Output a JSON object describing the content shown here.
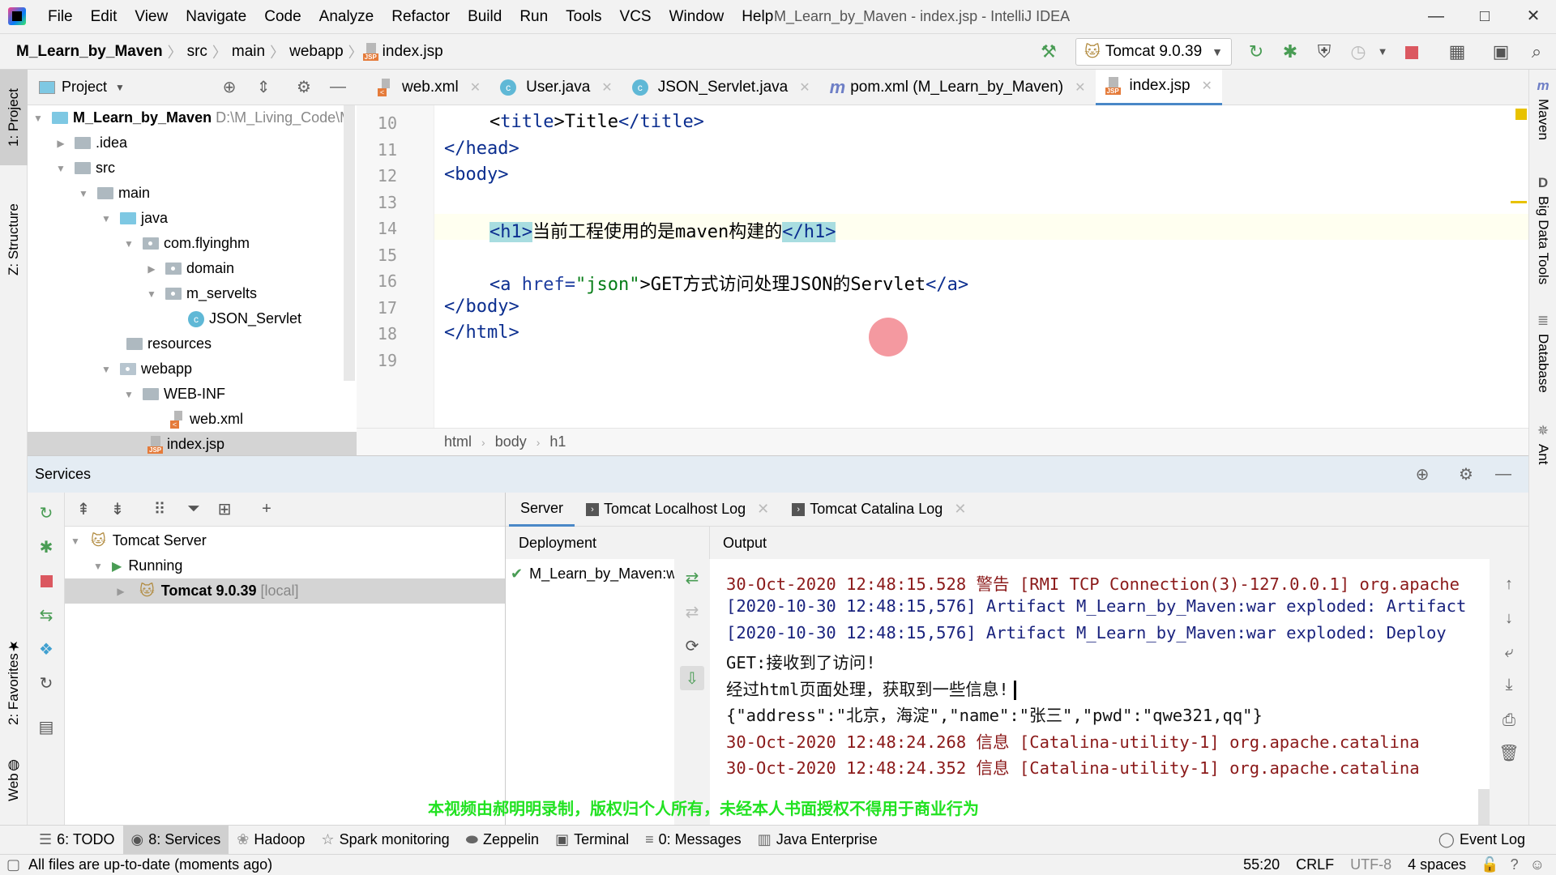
{
  "window": {
    "title": "M_Learn_by_Maven - index.jsp - IntelliJ IDEA",
    "menu": [
      "File",
      "Edit",
      "View",
      "Navigate",
      "Code",
      "Analyze",
      "Refactor",
      "Build",
      "Run",
      "Tools",
      "VCS",
      "Window",
      "Help"
    ],
    "controls": {
      "minimize": "—",
      "maximize": "□",
      "close": "✕"
    }
  },
  "navbar": {
    "breadcrumbs": [
      "M_Learn_by_Maven",
      "src",
      "main",
      "webapp",
      "index.jsp"
    ],
    "run_config": "Tomcat 9.0.39"
  },
  "left_strip": {
    "tabs": [
      "1: Project",
      "Z: Structure",
      "2: Favorites",
      "Web"
    ]
  },
  "right_strip": {
    "tabs": [
      "Maven",
      "Big Data Tools",
      "Database",
      "Ant"
    ]
  },
  "project": {
    "title": "Project",
    "root_path": "D:\\M_Living_Code\\M",
    "tree": [
      {
        "label": "M_Learn_by_Maven",
        "depth": 0,
        "type": "module",
        "expanded": true
      },
      {
        "label": ".idea",
        "depth": 1,
        "type": "folder",
        "expanded": false
      },
      {
        "label": "src",
        "depth": 1,
        "type": "folder",
        "expanded": true
      },
      {
        "label": "main",
        "depth": 2,
        "type": "folder",
        "expanded": true
      },
      {
        "label": "java",
        "depth": 3,
        "type": "src-folder",
        "expanded": true
      },
      {
        "label": "com.flyinghm",
        "depth": 4,
        "type": "package",
        "expanded": true
      },
      {
        "label": "domain",
        "depth": 5,
        "type": "package",
        "expanded": false
      },
      {
        "label": "m_servelts",
        "depth": 5,
        "type": "package",
        "expanded": true
      },
      {
        "label": "JSON_Servlet",
        "depth": 6,
        "type": "class"
      },
      {
        "label": "resources",
        "depth": 3,
        "type": "res-folder"
      },
      {
        "label": "webapp",
        "depth": 3,
        "type": "web-folder",
        "expanded": true
      },
      {
        "label": "WEB-INF",
        "depth": 4,
        "type": "folder",
        "expanded": true
      },
      {
        "label": "web.xml",
        "depth": 5,
        "type": "xml"
      },
      {
        "label": "index.jsp",
        "depth": 4,
        "type": "jsp",
        "selected": true
      }
    ]
  },
  "editor": {
    "tabs": [
      {
        "label": "web.xml",
        "icon": "xml"
      },
      {
        "label": "User.java",
        "icon": "class"
      },
      {
        "label": "JSON_Servlet.java",
        "icon": "class"
      },
      {
        "label": "pom.xml (M_Learn_by_Maven)",
        "icon": "maven"
      },
      {
        "label": "index.jsp",
        "icon": "jsp",
        "active": true
      }
    ],
    "line_numbers": [
      "10",
      "11",
      "12",
      "13",
      "14",
      "15",
      "16",
      "17",
      "18",
      "19"
    ],
    "lines": {
      "l10": {
        "indent": "    ",
        "open": "<",
        "tag": "title",
        "close": ">",
        "text": "Title",
        "etag": "</title>"
      },
      "l11": "</head>",
      "l12": "<body>",
      "l14": {
        "open": "<h1>",
        "text": "当前工程使用的是maven构建的",
        "close": "</h1>"
      },
      "l16": {
        "a_open": "<a ",
        "attr": "href=",
        "val": "\"json\"",
        "gt": ">",
        "text": "GET方式访问处理JSON的Servlet",
        "a_close": "</a>"
      },
      "l17": "</body>",
      "l18": "</html>"
    },
    "breadcrumb": [
      "html",
      "body",
      "h1"
    ]
  },
  "services": {
    "title": "Services",
    "tree": [
      {
        "label": "Tomcat Server"
      },
      {
        "label": "Running"
      },
      {
        "label": "Tomcat 9.0.39",
        "suffix": "[local]",
        "selected": true
      }
    ],
    "tabs": [
      {
        "label": "Server",
        "active": true
      },
      {
        "label": "Tomcat Localhost Log",
        "closable": true
      },
      {
        "label": "Tomcat Catalina Log",
        "closable": true
      }
    ],
    "deployment_header": "Deployment",
    "deployment_items": [
      "M_Learn_by_Maven:war exploded"
    ],
    "output_header": "Output",
    "output_lines": [
      {
        "text": "30-Oct-2020 12:48:15.528 警告 [RMI TCP Connection(3)-127.0.0.1] org.apache",
        "color": "red"
      },
      {
        "text": "[2020-10-30 12:48:15,576] Artifact M_Learn_by_Maven:war exploded: Artifact",
        "color": "blue"
      },
      {
        "text": "[2020-10-30 12:48:15,576] Artifact M_Learn_by_Maven:war exploded: Deploy",
        "color": "blue"
      },
      {
        "text": "GET:接收到了访问!",
        "color": "black"
      },
      {
        "text": "经过html页面处理，获取到一些信息!",
        "color": "black"
      },
      {
        "text": "{\"address\":\"北京，海淀\",\"name\":\"张三\",\"pwd\":\"qwe321,qq\"}",
        "color": "black"
      },
      {
        "text": "30-Oct-2020 12:48:24.268 信息 [Catalina-utility-1] org.apache.catalina",
        "color": "red"
      },
      {
        "text": "30-Oct-2020 12:48:24.352 信息 [Catalina-utility-1] org.apache.catalina",
        "color": "red"
      }
    ]
  },
  "watermark": "本视频由郝明明录制，版权归个人所有，未经本人书面授权不得用于商业行为",
  "tool_windows": [
    {
      "label": "6: TODO"
    },
    {
      "label": "8: Services",
      "active": true
    },
    {
      "label": "Hadoop"
    },
    {
      "label": "Spark monitoring"
    },
    {
      "label": "Zeppelin"
    },
    {
      "label": "Terminal"
    },
    {
      "label": "0: Messages"
    },
    {
      "label": "Java Enterprise"
    }
  ],
  "event_log": "Event Log",
  "status": {
    "message": "All files are up-to-date (moments ago)",
    "position": "55:20",
    "line_sep": "CRLF",
    "encoding": "UTF-8",
    "indent": "4 spaces"
  },
  "colors": {
    "accent": "#4a88c7",
    "run_green": "#499c54",
    "stop_red": "#db5860",
    "watermark": "#21e221"
  }
}
